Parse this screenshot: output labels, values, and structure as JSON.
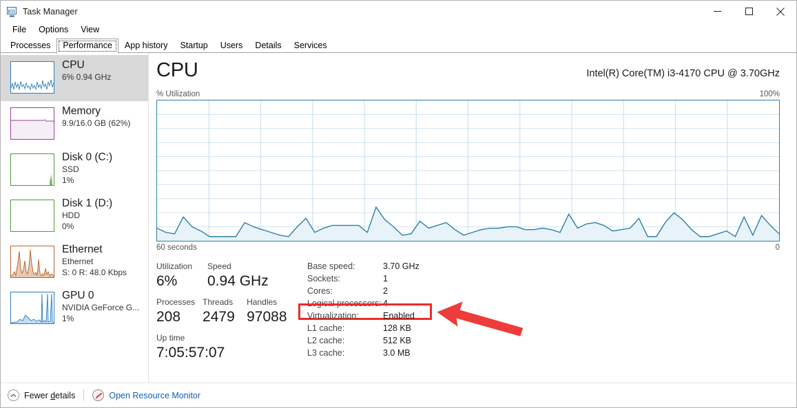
{
  "window": {
    "title": "Task Manager",
    "icon": "task-manager-icon",
    "controls": {
      "minimize": "—",
      "maximize": "□",
      "close": "✕"
    }
  },
  "menu": {
    "items": [
      "File",
      "Options",
      "View"
    ]
  },
  "tabs": {
    "items": [
      "Processes",
      "Performance",
      "App history",
      "Startup",
      "Users",
      "Details",
      "Services"
    ],
    "active": "Performance"
  },
  "sidebar": {
    "items": [
      {
        "title": "CPU",
        "sub1": "6%  0.94 GHz",
        "sub2": "",
        "color": "#2d7fc1",
        "selected": true
      },
      {
        "title": "Memory",
        "sub1": "9.9/16.0 GB (62%)",
        "sub2": "",
        "color": "#9b3fa0",
        "selected": false
      },
      {
        "title": "Disk 0 (C:)",
        "sub1": "SSD",
        "sub2": "1%",
        "color": "#4e9a35",
        "selected": false
      },
      {
        "title": "Disk 1 (D:)",
        "sub1": "HDD",
        "sub2": "0%",
        "color": "#4e9a35",
        "selected": false
      },
      {
        "title": "Ethernet",
        "sub1": "Ethernet",
        "sub2": "S: 0 R: 48.0 Kbps",
        "color": "#b6622a",
        "selected": false
      },
      {
        "title": "GPU 0",
        "sub1": "NVIDIA GeForce G...",
        "sub2": "1%",
        "color": "#2d7fc1",
        "selected": false
      }
    ]
  },
  "main": {
    "title": "CPU",
    "model": "Intel(R) Core(TM) i3-4170 CPU @ 3.70GHz",
    "graph_top_left": "% Utilization",
    "graph_top_right": "100%",
    "graph_bottom_left": "60 seconds",
    "graph_bottom_right": "0",
    "accent_color": "#2d7fa8"
  },
  "chart_data": {
    "type": "area",
    "title": "% Utilization",
    "xlabel": "60 seconds",
    "ylabel": "% Utilization",
    "ylim": [
      0,
      100
    ],
    "xlim": [
      60,
      0
    ],
    "grid": true,
    "legend": "none",
    "series": [
      {
        "name": "CPU Utilization",
        "color": "#2d7fa8",
        "fill": "#e8f2f9",
        "values": [
          9,
          6,
          5,
          17,
          10,
          7,
          3,
          3,
          3,
          3,
          13,
          10,
          8,
          6,
          4,
          3,
          10,
          16,
          6,
          9,
          11,
          11,
          11,
          11,
          6,
          24,
          15,
          10,
          4,
          5,
          14,
          9,
          11,
          13,
          8,
          4,
          6,
          8,
          9,
          9,
          10,
          10,
          8,
          8,
          9,
          8,
          6,
          19,
          9,
          12,
          13,
          11,
          7,
          8,
          9,
          16,
          3,
          3,
          13,
          20,
          15,
          8,
          3,
          3,
          5,
          7,
          3,
          17,
          4,
          18,
          11,
          5
        ]
      }
    ]
  },
  "stats": {
    "left": [
      {
        "caption": "Utilization",
        "value": "6%"
      },
      {
        "caption": "Speed",
        "value": "0.94 GHz"
      },
      {
        "caption": "Processes",
        "value": "208"
      },
      {
        "caption": "Threads",
        "value": "2479"
      },
      {
        "caption": "Handles",
        "value": "97088"
      },
      {
        "caption": "Up time",
        "value": "7:05:57:07"
      }
    ],
    "right": [
      {
        "key": "Base speed:",
        "value": "3.70 GHz",
        "highlight": false
      },
      {
        "key": "Sockets:",
        "value": "1",
        "highlight": false
      },
      {
        "key": "Cores:",
        "value": "2",
        "highlight": false
      },
      {
        "key": "Logical processors:",
        "value": "4",
        "highlight": false
      },
      {
        "key": "Virtualization:",
        "value": "Enabled",
        "highlight": true
      },
      {
        "key": "L1 cache:",
        "value": "128 KB",
        "highlight": false
      },
      {
        "key": "L2 cache:",
        "value": "512 KB",
        "highlight": false
      },
      {
        "key": "L3 cache:",
        "value": "3.0 MB",
        "highlight": false
      }
    ]
  },
  "annotation": {
    "highlight_color": "#ee2b2b",
    "arrow_color": "#ee3b3b",
    "target": "Virtualization: Enabled"
  },
  "footer": {
    "fewer_details": "Fewer details",
    "fewer_details_pre": "Fewer ",
    "fewer_details_accel": "d",
    "fewer_details_post": "etails",
    "resource_monitor": "Open Resource Monitor"
  }
}
